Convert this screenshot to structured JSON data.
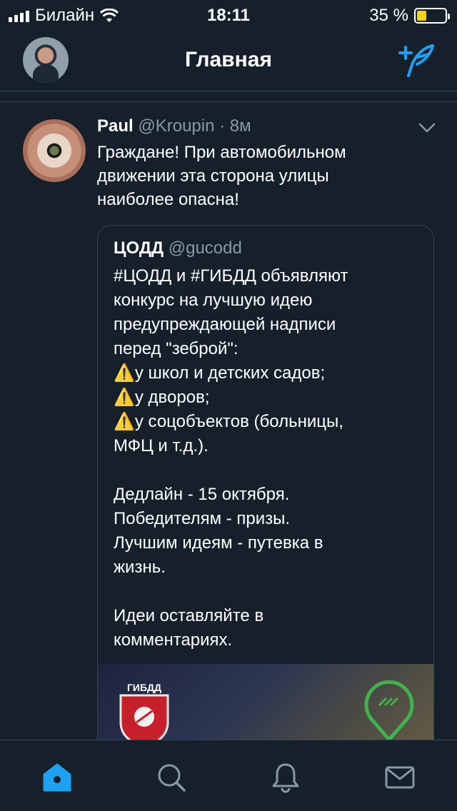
{
  "status_bar": {
    "carrier": "Билайн",
    "time": "18:11",
    "battery": "35 %",
    "battery_level": 0.35
  },
  "header": {
    "title": "Главная"
  },
  "tweet": {
    "name": "Paul",
    "handle": "@Kroupin · 8м",
    "text": "Граждане! При автомобильном\nдвижении эта сторона улицы\nнаиболее опасна!",
    "quoted": {
      "name": "ЦОДД",
      "handle": "@gucodd",
      "text": "#ЦОДД и #ГИБДД  объявляют\nконкурс на лучшую идею\nпредупреждающей надписи\nперед \"зеброй\":\n⚠️у школ и детских садов;\n⚠️у дворов;\n⚠️у соцобъектов (больницы,\nМФЦ и т.д.).\n\nДедлайн - 15 октября.\nПобедителям - призы.\nЛучшим идеям - путевка в\nжизнь.\n\nИдеи оставляйте в\nкомментариях.",
      "media_text": "ГИБДД"
    }
  },
  "tabs": [
    "home-icon",
    "search-icon",
    "bell-icon",
    "mail-icon"
  ],
  "colors": {
    "background": "#15202b",
    "accent": "#1da1f2",
    "secondary_text": "#8899a6",
    "border": "#38444d"
  }
}
